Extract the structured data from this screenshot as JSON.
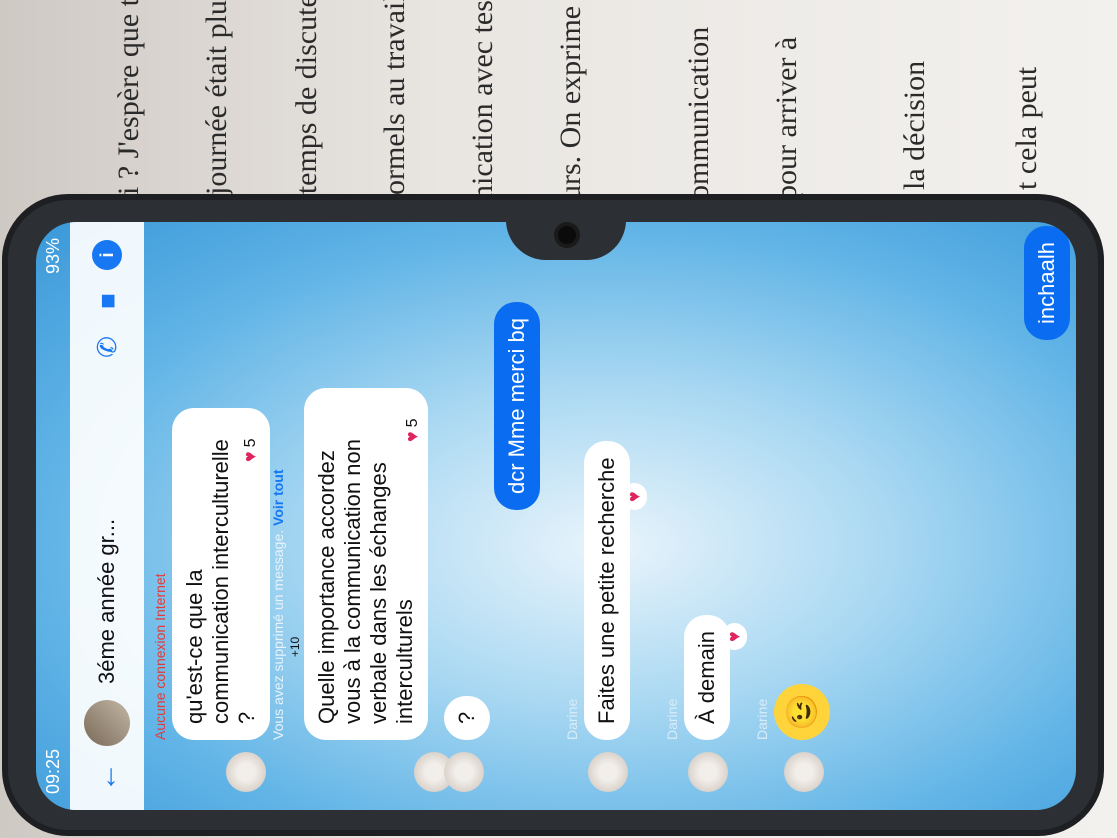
{
  "background_paper": {
    "lines": [
      "ui ? J'espère que tu a",
      "journée était plutô",
      "e temps de discuter",
      "formels au travail.",
      "nication avec tes",
      "urs. On exprime",
      "ommunication",
      "pour arriver à",
      "la décision",
      "t cela peut"
    ]
  },
  "status_bar": {
    "time": "09:25",
    "battery": "93%"
  },
  "header": {
    "title": "3éme année gr...",
    "back_icon": "←",
    "call_icon": "✆",
    "video_icon": "■",
    "info_icon": "i"
  },
  "network_warning": "Aucune connexion Internet",
  "messages": [
    {
      "text": "qu'est-ce que la communication interculturelle ?",
      "reaction_count": "5"
    },
    {
      "deleted_text": "Vous avez supprimé un message.",
      "see_all": "Voir tout"
    },
    {
      "text": "Quelle importance accordez vous à la communication non verbale dans les échanges interculturels",
      "reaction_count": "5"
    },
    {
      "text": "?"
    },
    {
      "text": "dcr Mme merci bq"
    },
    {
      "sender": "Darine",
      "text": "Faites une petite recherche"
    },
    {
      "sender": "Darine",
      "text": "À demain"
    },
    {
      "sender": "Darine",
      "emoji": "😉"
    },
    {
      "text": "inchaalh"
    }
  ],
  "seen_count": "+10",
  "colors": {
    "accent": "#1877f2",
    "my_bubble": "#0a6cf0",
    "heart": "#e0245e"
  }
}
